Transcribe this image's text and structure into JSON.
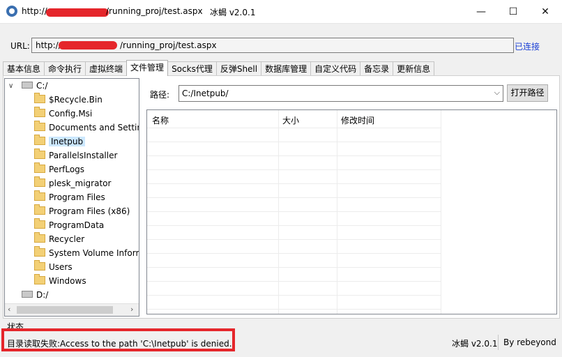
{
  "window": {
    "title_prefix": "http://",
    "title_suffix": "/running_proj/test.aspx",
    "app_name": "冰蝎 v2.0.1",
    "minimize": "—",
    "maximize": "☐",
    "close": "✕"
  },
  "url": {
    "label": "URL:",
    "prefix": "http://",
    "suffix": "/running_proj/test.aspx",
    "status": "已连接"
  },
  "tabs": [
    "基本信息",
    "命令执行",
    "虚拟终端",
    "文件管理",
    "Socks代理",
    "反弹Shell",
    "数据库管理",
    "自定义代码",
    "备忘录",
    "更新信息"
  ],
  "active_tab": "文件管理",
  "tree": {
    "drive_c": "C:/",
    "drive_d": "D:/",
    "folders": [
      "$Recycle.Bin",
      "Config.Msi",
      "Documents and Settin",
      "Inetpub",
      "ParallelsInstaller",
      "PerfLogs",
      "plesk_migrator",
      "Program Files",
      "Program Files (x86)",
      "ProgramData",
      "Recycler",
      "System Volume Inform",
      "Users",
      "Windows"
    ],
    "selected": "Inetpub",
    "expanded_marker": "∨",
    "scroll_left": "‹",
    "scroll_right": "›"
  },
  "path": {
    "label": "路径:",
    "value": "C:/Inetpub/",
    "open_button": "打开路径",
    "chevron": "⌵"
  },
  "grid": {
    "columns": [
      "名称",
      "大小",
      "修改时间"
    ]
  },
  "status": {
    "label": "状态",
    "message": "目录读取失败:Access to the path 'C:\\Inetpub' is denied.",
    "version": "冰蝎 v2.0.1",
    "author": "By rebeyond"
  },
  "colors": {
    "accent_link": "#1a3fd6",
    "redaction": "#e5262b",
    "selection": "#cce8ff"
  }
}
